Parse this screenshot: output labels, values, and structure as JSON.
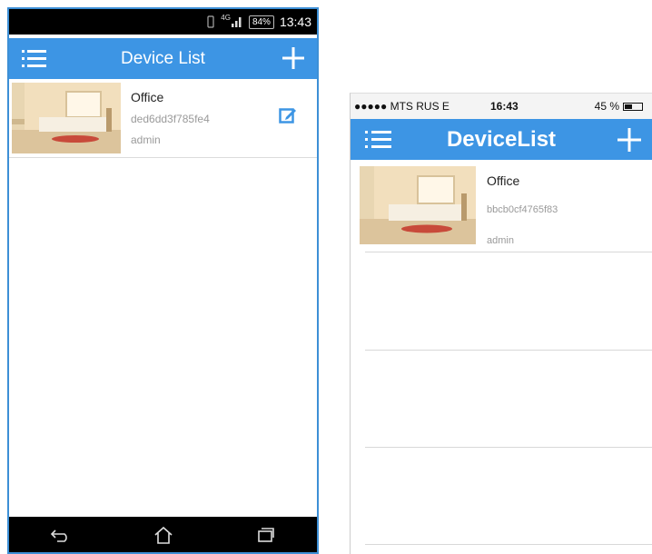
{
  "android": {
    "status": {
      "network": "4G",
      "battery": "84%",
      "time": "13:43"
    },
    "header": {
      "title": "Device List"
    },
    "devices": [
      {
        "name": "Office",
        "id": "ded6dd3f785fe4",
        "user": "admin"
      }
    ],
    "nav": {
      "icons": [
        "back-icon",
        "home-icon",
        "recent-apps-icon"
      ]
    }
  },
  "iphone": {
    "status": {
      "carrier": "●●●●● MTS RUS  E",
      "time": "16:43",
      "battery": "45 %",
      "battery_level": 0.45
    },
    "header": {
      "title": "DeviceList"
    },
    "devices": [
      {
        "name": "Office",
        "id": "bbcb0cf4765f83",
        "user": "admin"
      }
    ]
  },
  "colors": {
    "accent": "#3d95e4",
    "border": "#3d8fd6"
  }
}
